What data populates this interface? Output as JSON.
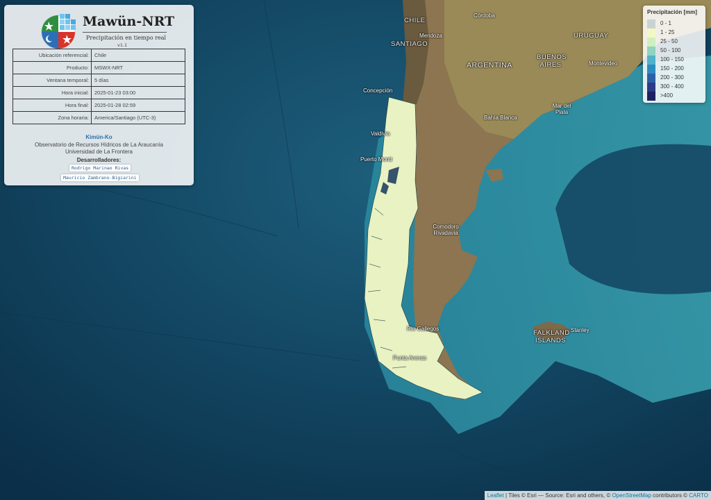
{
  "app": {
    "title": "Mawün-NRT",
    "subtitle": "Precipitación en tiempo real",
    "version": "v1.1"
  },
  "info": {
    "rows": [
      {
        "label": "Ubicación referencial:",
        "value": "Chile"
      },
      {
        "label": "Producto:",
        "value": "MSWX-NRT"
      },
      {
        "label": "Ventana temporal:",
        "value": "5 días"
      },
      {
        "label": "Hora inicial:",
        "value": "2025-01-23 03:00"
      },
      {
        "label": "Hora final:",
        "value": "2025-01-28 02:59"
      },
      {
        "label": "Zona horaria:",
        "value": "America/Santiago (UTC-3)"
      }
    ],
    "org_name": "Kimün-Ko",
    "org_line1": "Observatorio de Recursos Hídricos de La Araucanía",
    "org_line2": "Universidad de La Frontera",
    "developers_title": "Desarrolladores:",
    "developers": [
      "Rodrigo Marinao Rivas",
      "Mauricio Zambrano-Bigiarini"
    ]
  },
  "legend": {
    "title": "Precipitación [mm]",
    "classes": [
      {
        "label": "0 - 1",
        "color": "#c9d3d4"
      },
      {
        "label": "1 - 25",
        "color": "#f3f7c4"
      },
      {
        "label": "25 - 50",
        "color": "#d1eec1"
      },
      {
        "label": "50 - 100",
        "color": "#8fd3c0"
      },
      {
        "label": "100 - 150",
        "color": "#4fb3c9"
      },
      {
        "label": "150 - 200",
        "color": "#2b8cc0"
      },
      {
        "label": "200 - 300",
        "color": "#2d5fa6"
      },
      {
        "label": "300 - 400",
        "color": "#2b3b86"
      },
      {
        "label": ">400",
        "color": "#1e2160"
      }
    ]
  },
  "places": {
    "chile": "CHILE",
    "mendoza": "Mendoza",
    "santiago": "SANTIAGO",
    "cordoba": "Córdoba",
    "uruguay": "URUGUAY",
    "buenos_aires": "BUENOS AIRES",
    "argentina": "ARGENTINA",
    "montevideo": "Montevideo",
    "concepcion": "Concepción",
    "mar_del_plata": "Mar del Plata",
    "bahia_blanca": "Bahía Blanca",
    "valdivia": "Valdivia",
    "puerto_montt": "Puerto Montt",
    "comodoro": "Comodoro Rivadavia",
    "rio_gallegos": "Río Gallegos",
    "punta_arenas": "Punta Arenas",
    "falkland": "FALKLAND ISLANDS",
    "stanley": "Stanley"
  },
  "attribution": {
    "leaflet": "Leaflet",
    "tiles": " | Tiles © Esri — Source: Esri and others, © ",
    "osm": "OpenStreetMap",
    "contributors": " contributors © ",
    "carto": "CARTO"
  }
}
